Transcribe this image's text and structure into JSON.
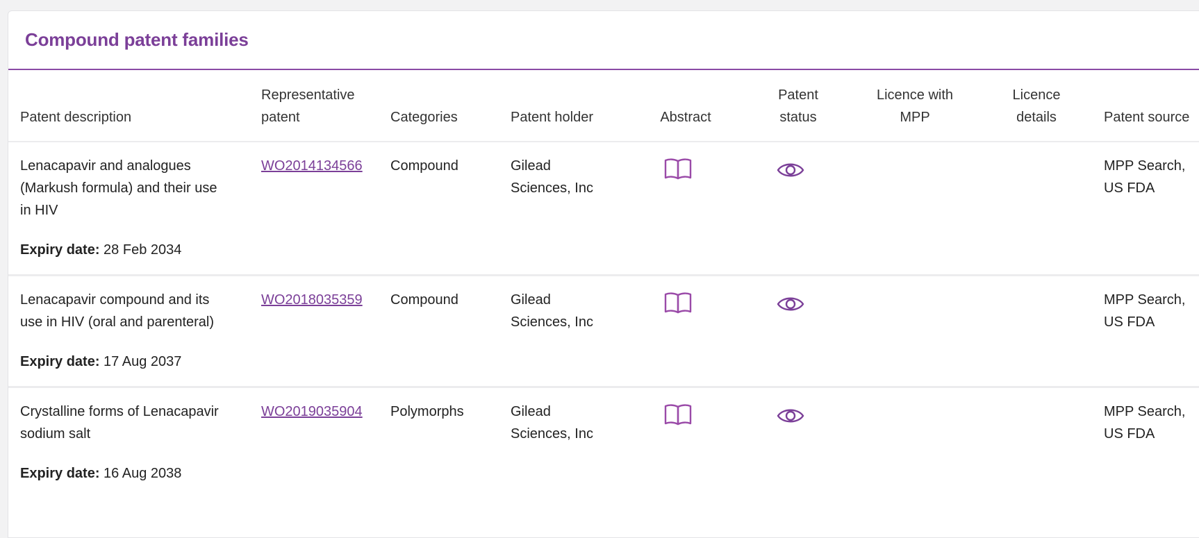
{
  "section": {
    "title": "Compound patent families"
  },
  "columns": {
    "description": [
      "Patent description"
    ],
    "representative": [
      "Representative",
      "patent"
    ],
    "categories": [
      "Categories"
    ],
    "holder": [
      "Patent holder"
    ],
    "abstract": [
      "Abstract"
    ],
    "status": [
      "Patent",
      "status"
    ],
    "licence_mpp": [
      "Licence with",
      "MPP"
    ],
    "licence_details": [
      "Licence",
      "details"
    ],
    "source": [
      "Patent source"
    ]
  },
  "accent_color": "#7b3f98",
  "rows": [
    {
      "description": [
        "Lenacapavir and analogues",
        "(Markush formula) and their use",
        "in HIV"
      ],
      "expiry_label": "Expiry date:",
      "expiry_value": "28 Feb 2034",
      "patent": "WO2014134566",
      "category": "Compound",
      "holder": [
        "Gilead",
        "Sciences, Inc"
      ],
      "abstract_icon": "book-icon",
      "status_icon": "eye-icon",
      "licence_mpp": "",
      "licence_details": "",
      "source": [
        "MPP Search,",
        "US FDA"
      ]
    },
    {
      "description": [
        "Lenacapavir compound and its",
        "use in HIV (oral and parenteral)"
      ],
      "expiry_label": "Expiry date:",
      "expiry_value": "17 Aug 2037",
      "patent": "WO2018035359",
      "category": "Compound",
      "holder": [
        "Gilead",
        "Sciences, Inc"
      ],
      "abstract_icon": "book-icon",
      "status_icon": "eye-icon",
      "licence_mpp": "",
      "licence_details": "",
      "source": [
        "MPP Search,",
        "US FDA"
      ]
    },
    {
      "description": [
        "Crystalline forms of Lenacapavir",
        "sodium salt"
      ],
      "expiry_label": "Expiry date:",
      "expiry_value": "16 Aug 2038",
      "patent": "WO2019035904",
      "category": "Polymorphs",
      "holder": [
        "Gilead",
        "Sciences, Inc"
      ],
      "abstract_icon": "book-icon",
      "status_icon": "eye-icon",
      "licence_mpp": "",
      "licence_details": "",
      "source": [
        "MPP Search,",
        "US FDA"
      ]
    }
  ]
}
